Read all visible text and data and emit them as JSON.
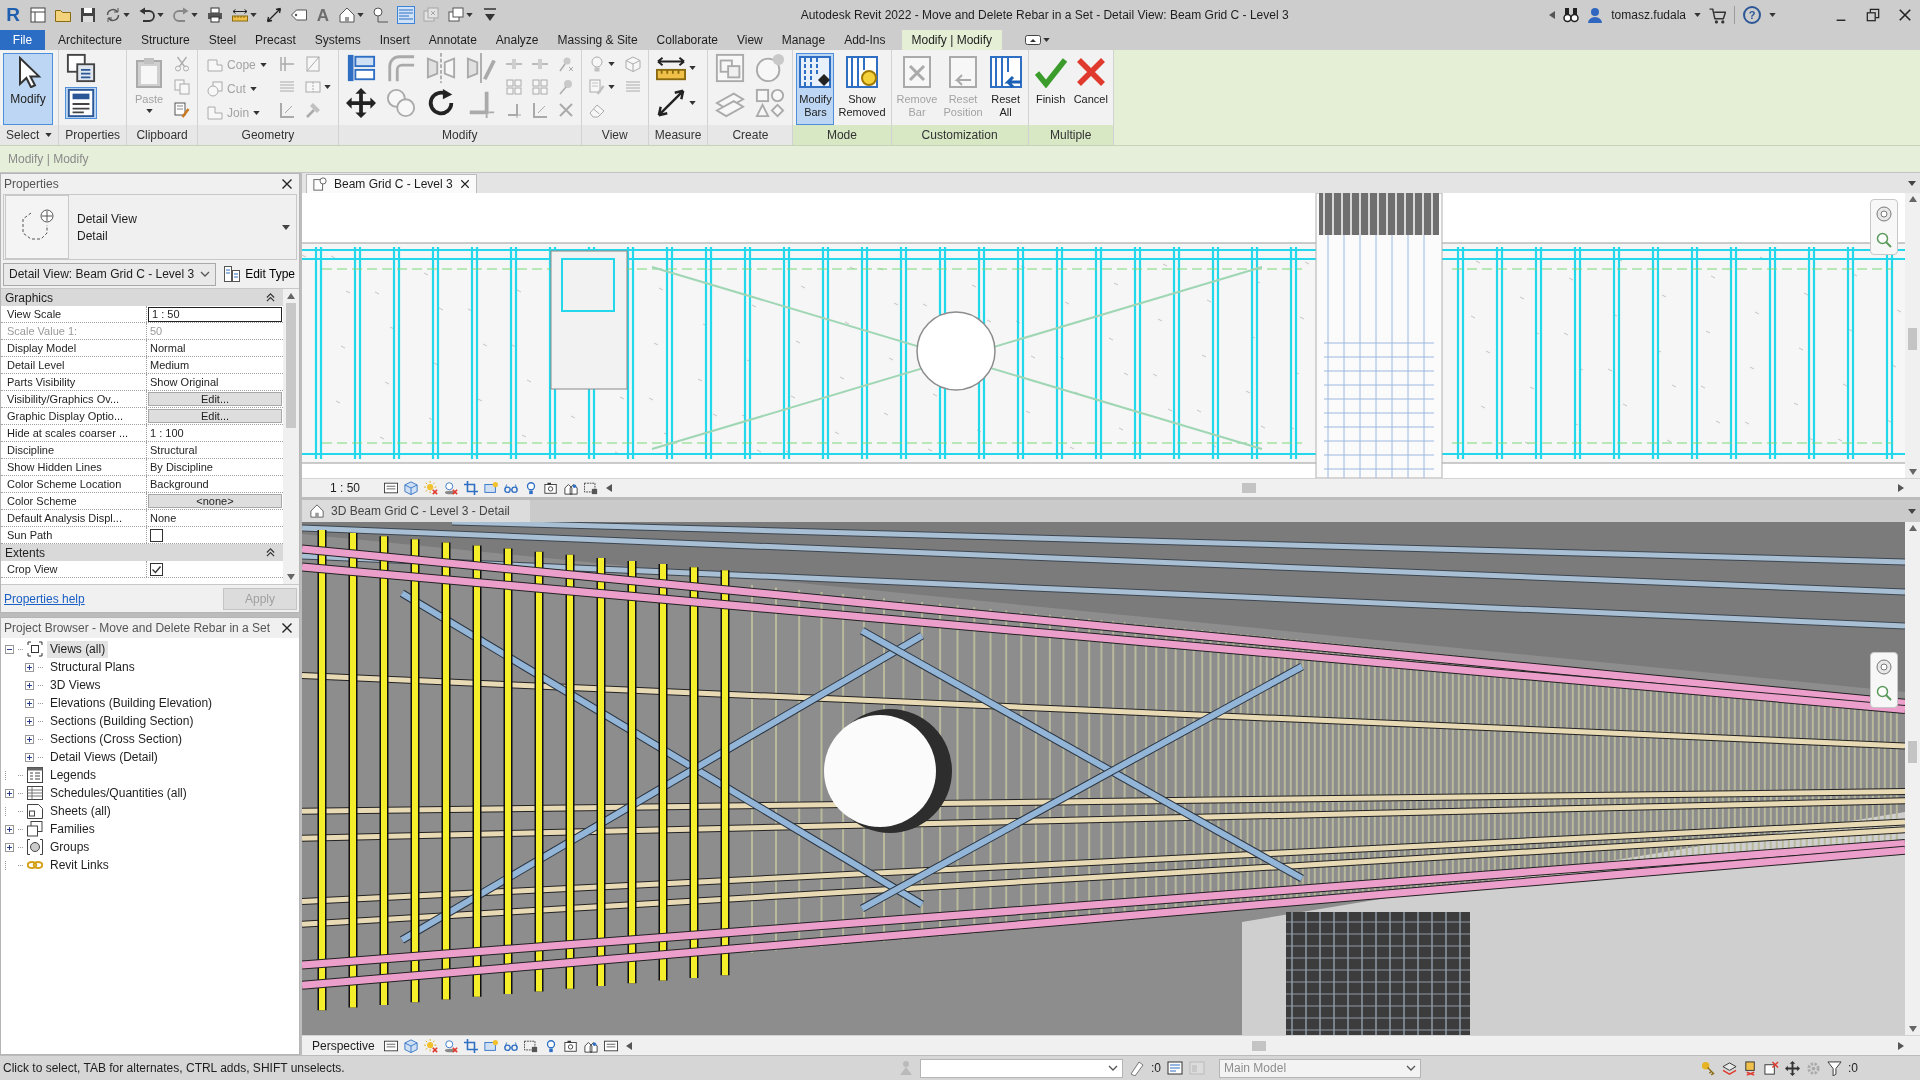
{
  "title_bar": {
    "logo": "R",
    "quick_access": [
      {
        "kind": "app",
        "disabled": false
      },
      {
        "kind": "open",
        "disabled": false
      },
      {
        "kind": "save",
        "disabled": false
      },
      {
        "kind": "sync",
        "disabled": false,
        "menu": true
      },
      {
        "kind": "undo",
        "disabled": false,
        "menu": true
      },
      {
        "kind": "redo",
        "disabled": true,
        "menu": true
      },
      {
        "kind": "print",
        "disabled": false
      },
      {
        "kind": "measure",
        "disabled": false,
        "menu": true
      },
      {
        "kind": "dimension",
        "disabled": false
      },
      {
        "kind": "tag",
        "disabled": false
      },
      {
        "kind": "text",
        "label": "A",
        "disabled": false
      },
      {
        "kind": "home3d",
        "disabled": false,
        "menu": true
      },
      {
        "kind": "section",
        "disabled": false
      },
      {
        "kind": "thinlines",
        "disabled": false,
        "on": true
      },
      {
        "kind": "closewin",
        "disabled": true
      },
      {
        "kind": "switchwin",
        "disabled": false,
        "menu": true
      },
      {
        "kind": "customize",
        "disabled": false
      }
    ],
    "title": "Autodesk Revit 2022 - Move and Delete Rebar in a Set - Detail View: Beam Grid C - Level 3",
    "user": "tomasz.fudala",
    "help": "?"
  },
  "ribbon": {
    "tabs": [
      {
        "label": "File",
        "kind": "file",
        "selected": false
      },
      {
        "label": "Architecture",
        "kind": "tab",
        "selected": false
      },
      {
        "label": "Structure",
        "kind": "tab",
        "selected": false
      },
      {
        "label": "Steel",
        "kind": "tab",
        "selected": false
      },
      {
        "label": "Precast",
        "kind": "tab",
        "selected": false
      },
      {
        "label": "Systems",
        "kind": "tab",
        "selected": false
      },
      {
        "label": "Insert",
        "kind": "tab",
        "selected": false
      },
      {
        "label": "Annotate",
        "kind": "tab",
        "selected": false
      },
      {
        "label": "Analyze",
        "kind": "tab",
        "selected": false
      },
      {
        "label": "Massing & Site",
        "kind": "tab",
        "selected": false
      },
      {
        "label": "Collaborate",
        "kind": "tab",
        "selected": false
      },
      {
        "label": "View",
        "kind": "tab",
        "selected": false
      },
      {
        "label": "Manage",
        "kind": "tab",
        "selected": false
      },
      {
        "label": "Add-Ins",
        "kind": "tab",
        "selected": false
      },
      {
        "label": "Modify | Modify",
        "kind": "contextual",
        "selected": true
      }
    ],
    "panels": [
      {
        "title": "Select",
        "menu": true,
        "contextual": false,
        "tools": [
          {
            "kind": "modify",
            "label": "Modify",
            "selected": true,
            "disabled": false
          }
        ]
      },
      {
        "title": "Properties",
        "contextual": false,
        "tools": [
          {
            "kind": "typeprops",
            "selected": false,
            "disabled": false
          },
          {
            "kind": "props",
            "selected": true,
            "disabled": false
          }
        ]
      },
      {
        "title": "Clipboard",
        "contextual": false,
        "tools": [
          {
            "kind": "paste",
            "label": "Paste",
            "menu": true,
            "selected": false,
            "disabled": true
          },
          {
            "kind": "cut",
            "selected": false,
            "disabled": true
          },
          {
            "kind": "copy",
            "selected": false,
            "disabled": true
          },
          {
            "kind": "match",
            "selected": false,
            "disabled": false
          }
        ]
      },
      {
        "title": "Geometry",
        "contextual": false,
        "tools": [
          {
            "kind": "cope",
            "label": "Cope",
            "menu": true,
            "selected": false,
            "disabled": true
          },
          {
            "kind": "cutgeom",
            "label": "Cut",
            "menu": true,
            "selected": false,
            "disabled": true
          },
          {
            "kind": "join",
            "label": "Join",
            "menu": true,
            "selected": false,
            "disabled": true
          },
          {
            "kind": "wallcorner",
            "selected": false,
            "disabled": true
          },
          {
            "kind": "stripes",
            "selected": false,
            "disabled": true
          },
          {
            "kind": "corner",
            "selected": false,
            "disabled": true
          },
          {
            "kind": "door",
            "selected": false,
            "disabled": true
          },
          {
            "kind": "splitface",
            "menu": true,
            "selected": false,
            "disabled": true
          },
          {
            "kind": "demolish",
            "selected": false,
            "disabled": true
          }
        ]
      },
      {
        "title": "Modify",
        "contextual": false,
        "tools": [
          {
            "kind": "align",
            "selected": false,
            "disabled": false
          },
          {
            "kind": "move",
            "selected": false,
            "disabled": false
          },
          {
            "kind": "offset",
            "selected": false,
            "disabled": true
          },
          {
            "kind": "copy2",
            "selected": false,
            "disabled": true
          },
          {
            "kind": "mirrorpick",
            "selected": false,
            "disabled": true
          },
          {
            "kind": "rotate",
            "selected": false,
            "disabled": false
          },
          {
            "kind": "mirrordraw",
            "selected": false,
            "disabled": true
          },
          {
            "kind": "trim",
            "selected": false,
            "disabled": true
          },
          {
            "kind": "split",
            "selected": false,
            "disabled": true
          },
          {
            "kind": "array",
            "selected": false,
            "disabled": true
          },
          {
            "kind": "trimext",
            "selected": false,
            "disabled": true
          },
          {
            "kind": "splitgap",
            "selected": false,
            "disabled": true
          },
          {
            "kind": "scale",
            "selected": false,
            "disabled": true
          },
          {
            "kind": "trimmulti",
            "selected": false,
            "disabled": true
          },
          {
            "kind": "unpin",
            "selected": false,
            "disabled": true
          },
          {
            "kind": "pin",
            "selected": false,
            "disabled": true
          },
          {
            "kind": "delete",
            "selected": false,
            "disabled": true
          }
        ]
      },
      {
        "title": "View",
        "contextual": false,
        "tools": [
          {
            "kind": "hide",
            "menu": true,
            "selected": false,
            "disabled": true
          },
          {
            "kind": "override",
            "menu": true,
            "selected": false,
            "disabled": true
          },
          {
            "kind": "linework",
            "selected": false,
            "disabled": true
          },
          {
            "kind": "cubestar",
            "selected": false,
            "disabled": true
          },
          {
            "kind": "lines",
            "selected": false,
            "disabled": true
          }
        ]
      },
      {
        "title": "Measure",
        "contextual": false,
        "tools": [
          {
            "kind": "measure",
            "menu": true,
            "selected": false,
            "disabled": false
          },
          {
            "kind": "dimension",
            "menu": true,
            "selected": false,
            "disabled": false
          }
        ]
      },
      {
        "title": "Create",
        "contextual": false,
        "tools": [
          {
            "kind": "group",
            "selected": false,
            "disabled": true
          },
          {
            "kind": "assembly",
            "selected": false,
            "disabled": true
          },
          {
            "kind": "similar",
            "selected": false,
            "disabled": true
          },
          {
            "kind": "parts",
            "selected": false,
            "disabled": true
          }
        ]
      },
      {
        "title": "Mode",
        "contextual": true,
        "tools": [
          {
            "kind": "bars",
            "label": "Modify Bars",
            "selected": true,
            "disabled": false
          },
          {
            "kind": "removed",
            "label": "Show Removed",
            "selected": false,
            "disabled": false
          }
        ]
      },
      {
        "title": "Customization",
        "contextual": true,
        "tools": [
          {
            "kind": "removebar",
            "label": "Remove Bar",
            "selected": false,
            "disabled": true
          },
          {
            "kind": "resetpos",
            "label": "Reset Position",
            "selected": false,
            "disabled": true
          },
          {
            "kind": "resetall",
            "label": "Reset All",
            "selected": false,
            "disabled": false
          }
        ]
      },
      {
        "title": "Multiple",
        "contextual": true,
        "tools": [
          {
            "kind": "finish",
            "label": "Finish",
            "selected": false,
            "disabled": false
          },
          {
            "kind": "cancel",
            "label": "Cancel",
            "selected": false,
            "disabled": false
          }
        ]
      }
    ]
  },
  "options_bar": {
    "label": "Modify | Modify"
  },
  "properties": {
    "title": "Properties",
    "type": {
      "family": "Detail View",
      "type": "Detail"
    },
    "instance": "Detail View: Beam Grid C - Level 3",
    "edit_type": "Edit Type",
    "sections": [
      {
        "title": "Graphics",
        "expanded": true,
        "rows": [
          {
            "label": "View Scale",
            "value": "1 : 50",
            "kind": "field",
            "disabled": false
          },
          {
            "label": "Scale Value 1:",
            "value": "50",
            "kind": "text",
            "disabled": true
          },
          {
            "label": "Display Model",
            "value": "Normal",
            "kind": "text",
            "disabled": false
          },
          {
            "label": "Detail Level",
            "value": "Medium",
            "kind": "text",
            "disabled": false
          },
          {
            "label": "Parts Visibility",
            "value": "Show Original",
            "kind": "text",
            "disabled": false
          },
          {
            "label": "Visibility/Graphics Ov...",
            "value": "Edit...",
            "kind": "button",
            "disabled": false
          },
          {
            "label": "Graphic Display Optio...",
            "value": "Edit...",
            "kind": "button",
            "disabled": false
          },
          {
            "label": "Hide at scales coarser ...",
            "value": "1 : 100",
            "kind": "text",
            "disabled": false
          },
          {
            "label": "Discipline",
            "value": "Structural",
            "kind": "text",
            "disabled": false
          },
          {
            "label": "Show Hidden Lines",
            "value": "By Discipline",
            "kind": "text",
            "disabled": false
          },
          {
            "label": "Color Scheme Location",
            "value": "Background",
            "kind": "text",
            "disabled": false
          },
          {
            "label": "Color Scheme",
            "value": "<none>",
            "kind": "button",
            "disabled": false
          },
          {
            "label": "Default Analysis Displ...",
            "value": "None",
            "kind": "text",
            "disabled": false
          },
          {
            "label": "Sun Path",
            "kind": "checkbox",
            "checked": false,
            "disabled": false
          }
        ]
      },
      {
        "title": "Extents",
        "expanded": true,
        "rows": [
          {
            "label": "Crop View",
            "kind": "checkbox",
            "checked": true,
            "disabled": false
          }
        ]
      }
    ],
    "help": "Properties help",
    "apply": {
      "label": "Apply",
      "disabled": true
    }
  },
  "project_browser": {
    "title": "Project Browser - Move and Delete Rebar in a Set",
    "tree": [
      {
        "label": "Views (all)",
        "kind": "views",
        "expanded": true,
        "selected": true,
        "children": [
          {
            "label": "Structural Plans",
            "expanded": false,
            "selected": false
          },
          {
            "label": "3D Views",
            "expanded": false,
            "selected": false
          },
          {
            "label": "Elevations (Building Elevation)",
            "expanded": false,
            "selected": false
          },
          {
            "label": "Sections (Building Section)",
            "expanded": false,
            "selected": false
          },
          {
            "label": "Sections (Cross Section)",
            "expanded": false,
            "selected": false
          },
          {
            "label": "Detail Views (Detail)",
            "expanded": false,
            "selected": false
          }
        ]
      },
      {
        "label": "Legends",
        "kind": "legends",
        "selected": false
      },
      {
        "label": "Schedules/Quantities (all)",
        "kind": "schedules",
        "expanded": false,
        "selected": false
      },
      {
        "label": "Sheets (all)",
        "kind": "sheets",
        "selected": false
      },
      {
        "label": "Families",
        "kind": "families",
        "expanded": false,
        "selected": false
      },
      {
        "label": "Groups",
        "kind": "groups",
        "expanded": false,
        "selected": false
      },
      {
        "label": "Revit Links",
        "kind": "links",
        "selected": false
      }
    ]
  },
  "views": [
    {
      "kind": "detail",
      "title": "Beam Grid C - Level 3",
      "scale": "1 : 50"
    },
    {
      "kind": "model",
      "title": "3D Beam Grid C - Level 3 - Detail",
      "projection": "Perspective"
    }
  ],
  "status_bar": {
    "message": "Click to select, TAB for alternates, CTRL adds, SHIFT unselects.",
    "editing_count": ":0",
    "design_option": {
      "value": "Main Model",
      "disabled": true
    },
    "selection_count": ":0"
  }
}
